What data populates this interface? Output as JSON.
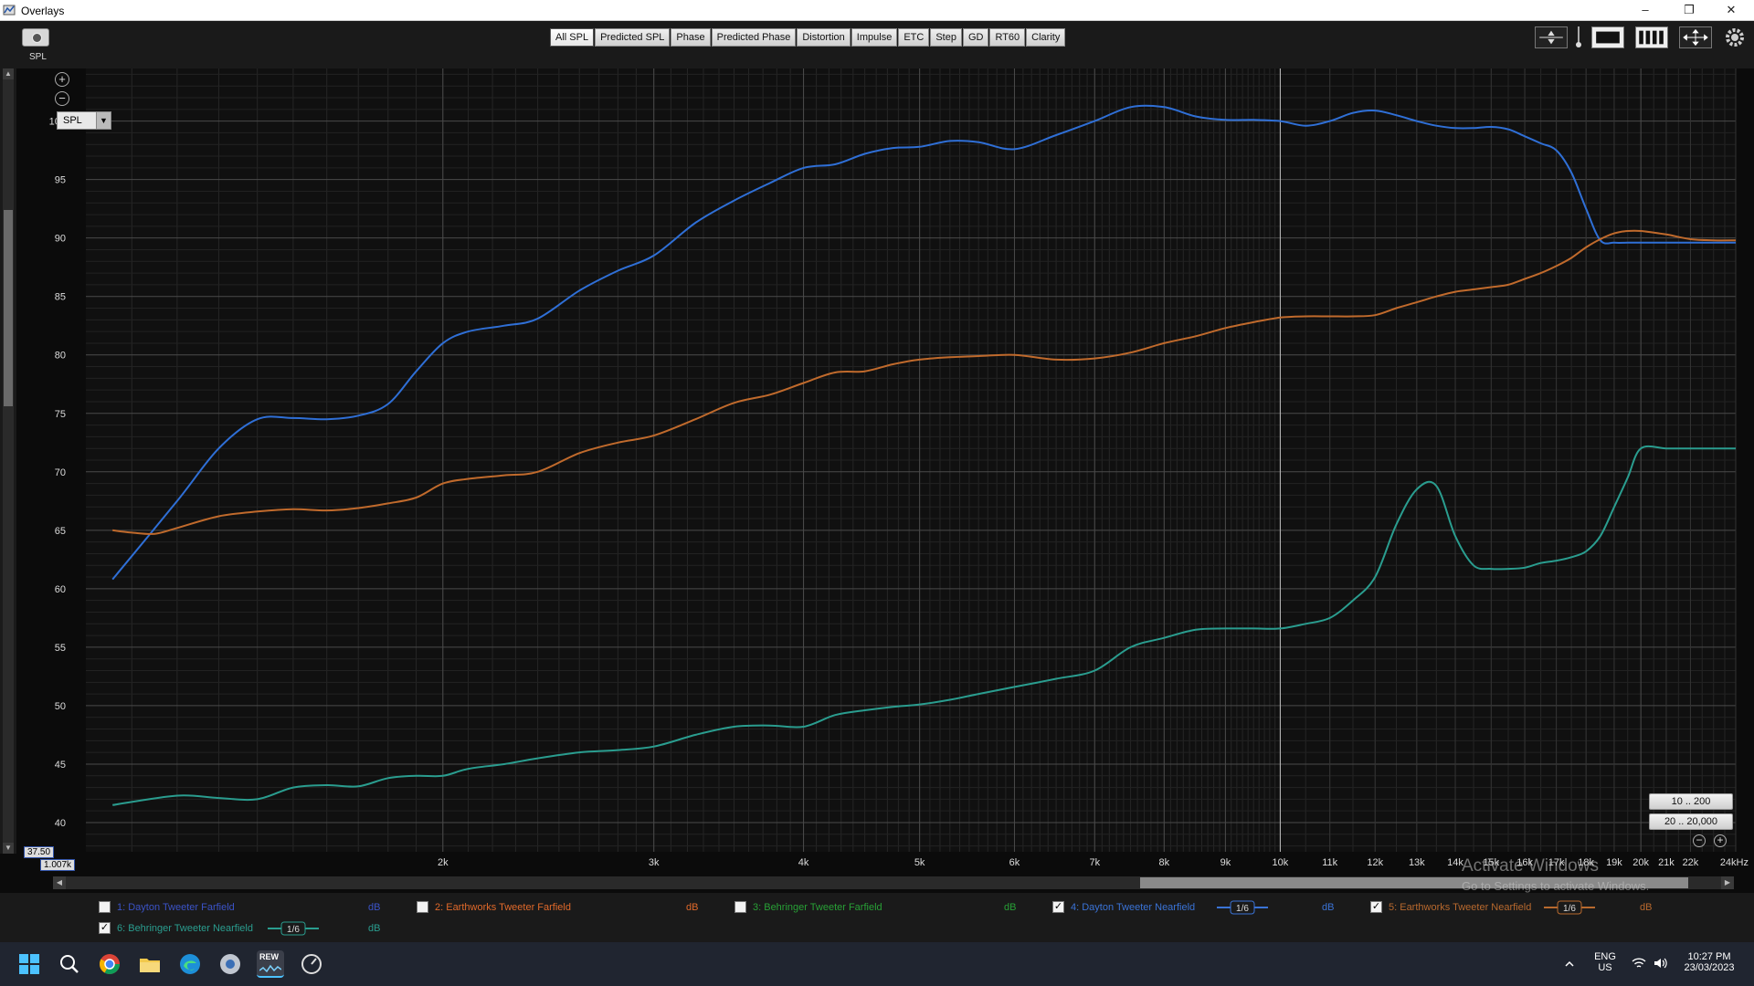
{
  "window": {
    "title": "Overlays",
    "controls": {
      "minimize": "–",
      "maximize": "❐",
      "close": "✕"
    }
  },
  "toolbar": {
    "capture_label": "SPL",
    "tabs": [
      "All SPL",
      "Predicted SPL",
      "Phase",
      "Predicted Phase",
      "Distortion",
      "Impulse",
      "ETC",
      "Step",
      "GD",
      "RT60",
      "Clarity"
    ],
    "active_tab": "All SPL"
  },
  "graph": {
    "select_value": "SPL",
    "min_value_box": "37.50",
    "min_freq_box": "1.007k",
    "range_buttons": [
      "10 .. 200",
      "20 .. 20,000"
    ]
  },
  "legend": {
    "items": [
      {
        "label": "1: Dayton Tweeter Farfield",
        "checked": false,
        "color": "#3b53c7",
        "unit": "dB",
        "smoothing": ""
      },
      {
        "label": "2: Earthworks Tweeter Farfield",
        "checked": false,
        "color": "#e0692a",
        "unit": "dB",
        "smoothing": ""
      },
      {
        "label": "3: Behringer Tweeter Farfield",
        "checked": false,
        "color": "#28a036",
        "unit": "dB",
        "smoothing": ""
      },
      {
        "label": "4: Dayton Tweeter Nearfield",
        "checked": true,
        "color": "#3a73d6",
        "unit": "dB",
        "smoothing": "1/6"
      },
      {
        "label": "5: Earthworks Tweeter Nearfield",
        "checked": true,
        "color": "#b8692e",
        "unit": "dB",
        "smoothing": "1/6"
      },
      {
        "label": "6: Behringer Tweeter Nearfield",
        "checked": true,
        "color": "#2a9d8f",
        "unit": "dB",
        "smoothing": "1/6"
      }
    ]
  },
  "watermark": {
    "line1": "Activate Windows",
    "line2": "Go to Settings to activate Windows."
  },
  "taskbar": {
    "apps": [
      "windows-start",
      "search",
      "chrome",
      "file-explorer",
      "edge",
      "media-app",
      "rew",
      "speedometer-app"
    ],
    "active_app_label": "REW",
    "lang_line1": "ENG",
    "lang_line2": "US",
    "time": "10:27 PM",
    "date": "23/03/2023"
  },
  "chart_data": {
    "type": "line",
    "xlabel": "",
    "ylabel": "",
    "x_scale": "log",
    "xlim": [
      1007,
      24000
    ],
    "ylim": [
      37.5,
      104.5
    ],
    "x_ticks": [
      {
        "f": 2000,
        "label": "2k"
      },
      {
        "f": 3000,
        "label": "3k"
      },
      {
        "f": 4000,
        "label": "4k"
      },
      {
        "f": 5000,
        "label": "5k"
      },
      {
        "f": 6000,
        "label": "6k"
      },
      {
        "f": 7000,
        "label": "7k"
      },
      {
        "f": 8000,
        "label": "8k"
      },
      {
        "f": 9000,
        "label": "9k"
      },
      {
        "f": 10000,
        "label": "10k"
      },
      {
        "f": 11000,
        "label": "11k"
      },
      {
        "f": 12000,
        "label": "12k"
      },
      {
        "f": 13000,
        "label": "13k"
      },
      {
        "f": 14000,
        "label": "14k"
      },
      {
        "f": 15000,
        "label": "15k"
      },
      {
        "f": 16000,
        "label": "16k"
      },
      {
        "f": 17000,
        "label": "17k"
      },
      {
        "f": 18000,
        "label": "18k"
      },
      {
        "f": 19000,
        "label": "19k"
      },
      {
        "f": 20000,
        "label": "20k"
      },
      {
        "f": 21000,
        "label": "21k"
      },
      {
        "f": 22000,
        "label": "22k"
      },
      {
        "f": 24000,
        "label": "24kHz"
      }
    ],
    "y_ticks": [
      40,
      45,
      50,
      55,
      60,
      65,
      70,
      75,
      80,
      85,
      90,
      95,
      100
    ],
    "cursor_x": 10000,
    "series": [
      {
        "name": "4: Dayton Tweeter Nearfield",
        "color": "#2f6fd6",
        "x": [
          1060,
          1200,
          1300,
          1400,
          1500,
          1600,
          1700,
          1800,
          1900,
          2000,
          2100,
          2250,
          2400,
          2600,
          2800,
          3000,
          3250,
          3500,
          3750,
          4000,
          4250,
          4500,
          4750,
          5000,
          5300,
          5600,
          6000,
          6500,
          7000,
          7500,
          8000,
          8500,
          9000,
          9500,
          10000,
          10500,
          11000,
          11500,
          12000,
          12500,
          13000,
          13500,
          14000,
          14500,
          15000,
          15500,
          16000,
          16500,
          17000,
          17500,
          18000,
          18500,
          19000,
          19500,
          20000,
          20500,
          21000,
          21500,
          22000,
          22500,
          23000,
          23500,
          24000
        ],
        "y": [
          60.8,
          67.5,
          72,
          74.5,
          74.6,
          74.5,
          74.8,
          75.8,
          78.6,
          81,
          82,
          82.5,
          83.1,
          85.5,
          87.2,
          88.5,
          91.3,
          93.2,
          94.7,
          96,
          96.3,
          97.2,
          97.7,
          97.8,
          98.3,
          98.2,
          97.6,
          98.8,
          100,
          101.2,
          101.2,
          100.4,
          100.1,
          100.1,
          100,
          99.6,
          100,
          100.7,
          100.9,
          100.5,
          100,
          99.6,
          99.4,
          99.4,
          99.5,
          99.3,
          98.7,
          98.1,
          97.5,
          95.6,
          92.5,
          89.8,
          89.6,
          89.6,
          89.6,
          89.6,
          89.6,
          89.6,
          89.6,
          89.6,
          89.6,
          89.6,
          89.6
        ]
      },
      {
        "name": "5: Earthworks Tweeter Nearfield",
        "color": "#c06a2c",
        "x": [
          1060,
          1100,
          1150,
          1200,
          1300,
          1400,
          1500,
          1600,
          1700,
          1800,
          1900,
          2000,
          2100,
          2250,
          2400,
          2600,
          2800,
          3000,
          3250,
          3500,
          3750,
          4000,
          4250,
          4500,
          4750,
          5000,
          5300,
          5600,
          6000,
          6500,
          7000,
          7500,
          8000,
          8500,
          9000,
          9500,
          10000,
          10500,
          11000,
          11500,
          12000,
          12500,
          13000,
          13500,
          14000,
          14500,
          15000,
          15500,
          16000,
          16500,
          17000,
          17500,
          18000,
          18500,
          19000,
          19500,
          20000,
          21000,
          22000,
          23000,
          24000
        ],
        "y": [
          65,
          64.8,
          64.7,
          65.2,
          66.2,
          66.6,
          66.8,
          66.7,
          66.9,
          67.3,
          67.8,
          69,
          69.4,
          69.7,
          70,
          71.6,
          72.5,
          73.1,
          74.5,
          75.9,
          76.6,
          77.6,
          78.5,
          78.6,
          79.2,
          79.6,
          79.8,
          79.9,
          80,
          79.6,
          79.7,
          80.2,
          81,
          81.6,
          82.3,
          82.8,
          83.2,
          83.3,
          83.3,
          83.3,
          83.4,
          84,
          84.5,
          85,
          85.4,
          85.6,
          85.8,
          86,
          86.5,
          87,
          87.6,
          88.3,
          89.2,
          89.9,
          90.4,
          90.6,
          90.6,
          90.3,
          89.9,
          89.8,
          89.8
        ]
      },
      {
        "name": "6: Behringer Tweeter Nearfield",
        "color": "#2a9d8f",
        "x": [
          1060,
          1200,
          1300,
          1400,
          1500,
          1600,
          1700,
          1800,
          1900,
          2000,
          2100,
          2250,
          2400,
          2600,
          2800,
          3000,
          3250,
          3500,
          3750,
          4000,
          4250,
          4500,
          4750,
          5000,
          5300,
          5600,
          6000,
          6500,
          7000,
          7500,
          8000,
          8500,
          9000,
          9500,
          10000,
          10500,
          11000,
          11500,
          12000,
          12500,
          13000,
          13500,
          14000,
          14500,
          15000,
          15500,
          16000,
          16500,
          17000,
          17500,
          18000,
          18500,
          19000,
          19500,
          20000,
          21000,
          22000,
          23000,
          24000
        ],
        "y": [
          41.5,
          42.3,
          42.1,
          42,
          43,
          43.2,
          43.1,
          43.8,
          44,
          44,
          44.6,
          45,
          45.5,
          46,
          46.2,
          46.5,
          47.5,
          48.2,
          48.3,
          48.2,
          49.2,
          49.6,
          49.9,
          50.1,
          50.5,
          51,
          51.6,
          52.3,
          53,
          55,
          55.8,
          56.5,
          56.6,
          56.6,
          56.6,
          57,
          57.5,
          59,
          61,
          65.5,
          68.5,
          68.8,
          64.5,
          62,
          61.7,
          61.7,
          61.8,
          62.2,
          62.4,
          62.7,
          63.2,
          64.5,
          67,
          69.5,
          72,
          72,
          72,
          72,
          72
        ]
      }
    ]
  }
}
